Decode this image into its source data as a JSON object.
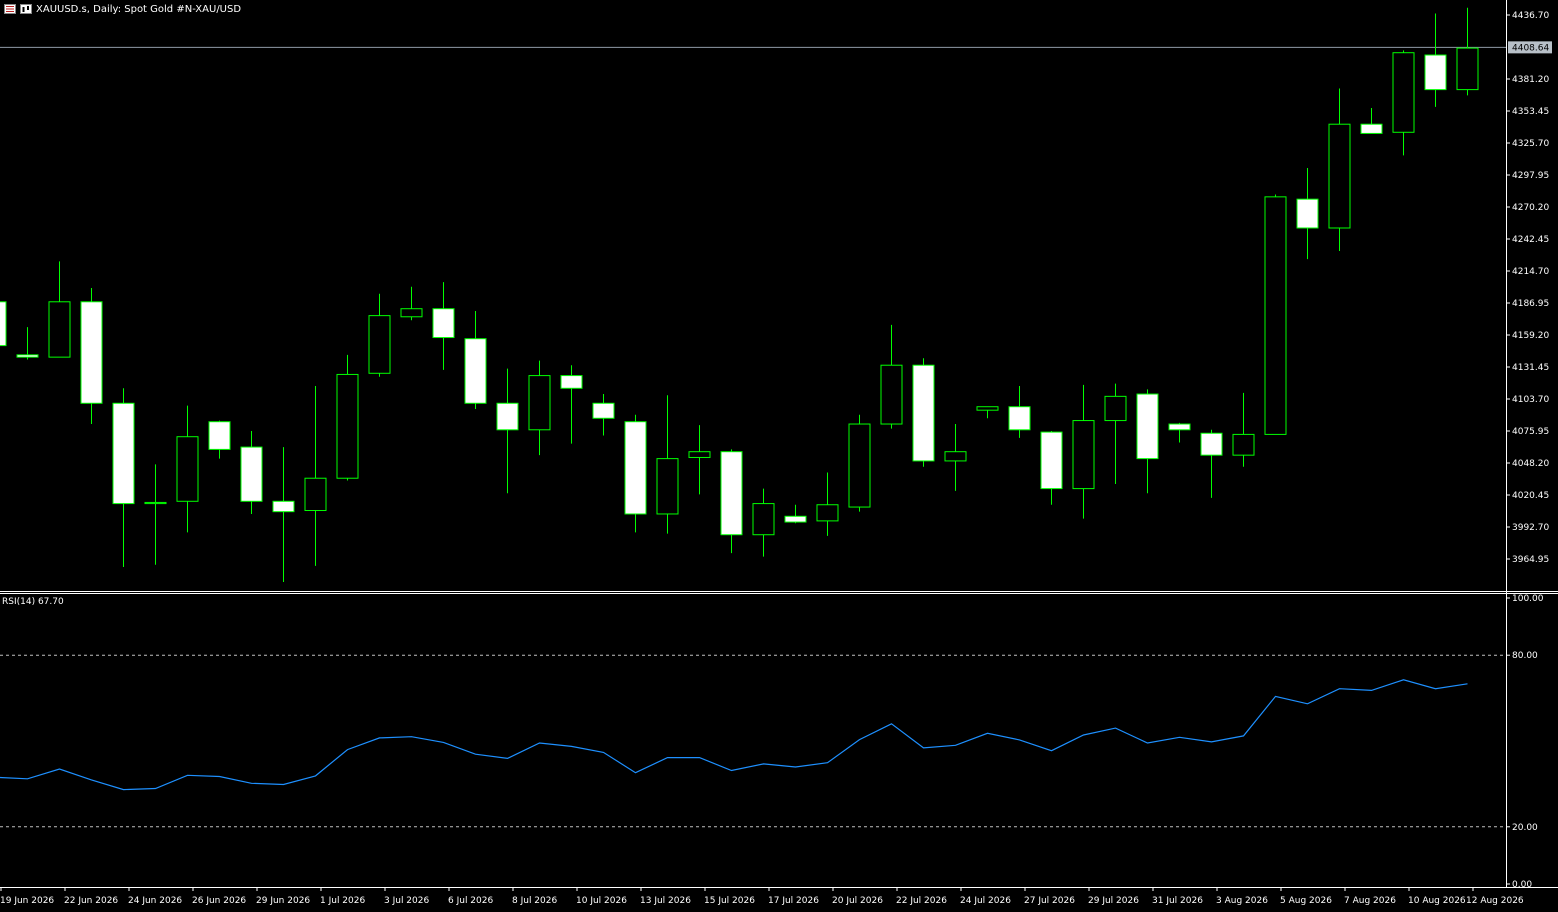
{
  "header": {
    "symbol_line": "XAUUSD.s, Daily:  Spot Gold #N-XAU/USD"
  },
  "price_axis": {
    "current_price_label": "4408.64",
    "current_price": 4408.64
  },
  "rsi_panel": {
    "label": "RSI(14) 67.70",
    "level_labels": [
      "100.00",
      "80.00",
      "20.00",
      "0.00"
    ]
  },
  "colors": {
    "background": "#000000",
    "candle_border": "#00ff00",
    "bull_fill": "#000000",
    "bear_fill": "#ffffff",
    "rsi_line": "#1e90ff",
    "axis_text": "#ffffff",
    "grid_line": "#c0c0c0"
  },
  "chart_data": {
    "type": "candlestick",
    "title": "XAUUSD.s, Daily:  Spot Gold #N-XAU/USD",
    "price_ylim": [
      3940,
      4450
    ],
    "price_ticks": [
      "4436.70",
      "4381.20",
      "4353.45",
      "4325.70",
      "4297.95",
      "4270.20",
      "4242.45",
      "4214.70",
      "4186.95",
      "4159.20",
      "4131.45",
      "4103.70",
      "4075.95",
      "4048.20",
      "4020.45",
      "3992.70",
      "3964.95"
    ],
    "date_labels": [
      "19 Jun 2026",
      "22 Jun 2026",
      "24 Jun 2026",
      "26 Jun 2026",
      "29 Jun 2026",
      "1 Jul 2026",
      "3 Jul 2026",
      "6 Jul 2026",
      "8 Jul 2026",
      "10 Jul 2026",
      "13 Jul 2026",
      "15 Jul 2026",
      "17 Jul 2026",
      "20 Jul 2026",
      "22 Jul 2026",
      "24 Jul 2026",
      "27 Jul 2026",
      "29 Jul 2026",
      "31 Jul 2026",
      "3 Aug 2026",
      "5 Aug 2026",
      "7 Aug 2026",
      "10 Aug 2026",
      "12 Aug 2026"
    ],
    "candles": [
      {
        "o": 4188,
        "h": 4192,
        "l": 4150,
        "c": 4150
      },
      {
        "o": 4142,
        "h": 4166,
        "l": 4138,
        "c": 4140
      },
      {
        "o": 4140,
        "h": 4223,
        "l": 4140,
        "c": 4188
      },
      {
        "o": 4188,
        "h": 4200,
        "l": 4082,
        "c": 4100
      },
      {
        "o": 4100,
        "h": 4113,
        "l": 3958,
        "c": 4013
      },
      {
        "o": 4013,
        "h": 4047,
        "l": 3960,
        "c": 4014
      },
      {
        "o": 4015,
        "h": 4098,
        "l": 3988,
        "c": 4071
      },
      {
        "o": 4084,
        "h": 4085,
        "l": 4052,
        "c": 4060
      },
      {
        "o": 4062,
        "h": 4076,
        "l": 4004,
        "c": 4015
      },
      {
        "o": 4015,
        "h": 4062,
        "l": 3945,
        "c": 4006
      },
      {
        "o": 4007,
        "h": 4115,
        "l": 3959,
        "c": 4035
      },
      {
        "o": 4035,
        "h": 4142,
        "l": 4033,
        "c": 4125
      },
      {
        "o": 4126,
        "h": 4195,
        "l": 4123,
        "c": 4176
      },
      {
        "o": 4175,
        "h": 4201,
        "l": 4172,
        "c": 4182
      },
      {
        "o": 4182,
        "h": 4205,
        "l": 4129,
        "c": 4157
      },
      {
        "o": 4156,
        "h": 4180,
        "l": 4095,
        "c": 4100
      },
      {
        "o": 4100,
        "h": 4130,
        "l": 4022,
        "c": 4077
      },
      {
        "o": 4077,
        "h": 4137,
        "l": 4055,
        "c": 4124
      },
      {
        "o": 4124,
        "h": 4133,
        "l": 4065,
        "c": 4113
      },
      {
        "o": 4100,
        "h": 4108,
        "l": 4072,
        "c": 4087
      },
      {
        "o": 4084,
        "h": 4090,
        "l": 3988,
        "c": 4004
      },
      {
        "o": 4004,
        "h": 4107,
        "l": 3987,
        "c": 4052
      },
      {
        "o": 4053,
        "h": 4081,
        "l": 4021,
        "c": 4058
      },
      {
        "o": 4058,
        "h": 4060,
        "l": 3970,
        "c": 3986
      },
      {
        "o": 3986,
        "h": 4026,
        "l": 3967,
        "c": 4013
      },
      {
        "o": 4002,
        "h": 4012,
        "l": 3996,
        "c": 3997
      },
      {
        "o": 3998,
        "h": 4040,
        "l": 3985,
        "c": 4012
      },
      {
        "o": 4010,
        "h": 4090,
        "l": 4006,
        "c": 4082
      },
      {
        "o": 4082,
        "h": 4168,
        "l": 4078,
        "c": 4133
      },
      {
        "o": 4133,
        "h": 4139,
        "l": 4045,
        "c": 4050
      },
      {
        "o": 4050,
        "h": 4082,
        "l": 4024,
        "c": 4058
      },
      {
        "o": 4094,
        "h": 4097,
        "l": 4087,
        "c": 4097
      },
      {
        "o": 4097,
        "h": 4115,
        "l": 4070,
        "c": 4077
      },
      {
        "o": 4075,
        "h": 4076,
        "l": 4012,
        "c": 4026
      },
      {
        "o": 4026,
        "h": 4116,
        "l": 4000,
        "c": 4085
      },
      {
        "o": 4085,
        "h": 4117,
        "l": 4030,
        "c": 4106
      },
      {
        "o": 4108,
        "h": 4112,
        "l": 4022,
        "c": 4052
      },
      {
        "o": 4082,
        "h": 4083,
        "l": 4066,
        "c": 4077
      },
      {
        "o": 4074,
        "h": 4077,
        "l": 4018,
        "c": 4055
      },
      {
        "o": 4055,
        "h": 4109,
        "l": 4045,
        "c": 4073
      },
      {
        "o": 4073,
        "h": 4281,
        "l": 4073,
        "c": 4279
      },
      {
        "o": 4277,
        "h": 4304,
        "l": 4225,
        "c": 4252
      },
      {
        "o": 4252,
        "h": 4373,
        "l": 4232,
        "c": 4342
      },
      {
        "o": 4342,
        "h": 4356,
        "l": 4334,
        "c": 4334
      },
      {
        "o": 4335,
        "h": 4406,
        "l": 4315,
        "c": 4404
      },
      {
        "o": 4402,
        "h": 4438,
        "l": 4357,
        "c": 4372
      },
      {
        "o": 4372,
        "h": 4443,
        "l": 4367,
        "c": 4408
      }
    ],
    "rsi": {
      "name": "RSI(14)",
      "last": 67.7,
      "ylim": [
        0,
        100
      ],
      "levels": [
        20,
        80
      ],
      "values": [
        37.3,
        36.8,
        40.2,
        36.4,
        33.0,
        33.4,
        38.0,
        37.6,
        35.2,
        34.8,
        37.8,
        47.0,
        51.1,
        51.5,
        49.5,
        45.4,
        43.9,
        49.3,
        48.1,
        46.0,
        38.9,
        44.2,
        44.2,
        39.7,
        42.0,
        40.9,
        42.4,
        50.5,
        56.0,
        47.6,
        48.5,
        52.7,
        50.4,
        46.6,
        52.1,
        54.5,
        49.3,
        51.3,
        49.7,
        51.8,
        65.6,
        63.0,
        68.3,
        67.7,
        71.4,
        68.3,
        70.0
      ]
    }
  }
}
